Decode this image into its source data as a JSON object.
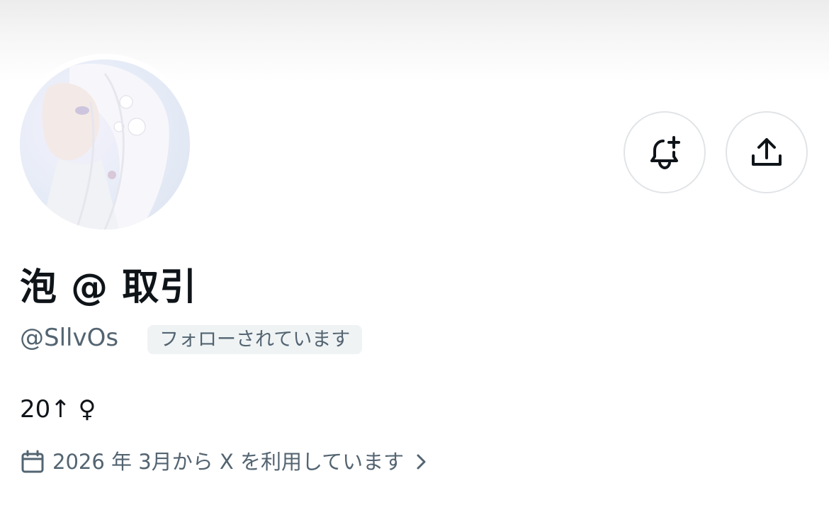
{
  "profile": {
    "display_name": "泡 @ 取引",
    "handle": "@SllvOs",
    "follows_you_badge": "フォローされています",
    "bio": "20↑ ♀",
    "joined": "2026 年 3月から X を利用しています"
  },
  "actions": {
    "notify_icon": "bell-plus-icon",
    "share_icon": "share-icon"
  },
  "icons": {
    "calendar": "calendar-icon",
    "chevron": "chevron-right-icon"
  },
  "colors": {
    "text_primary": "#0f1419",
    "text_secondary": "#536471",
    "badge_bg": "#eff3f4",
    "button_border": "#e1e4e7"
  }
}
